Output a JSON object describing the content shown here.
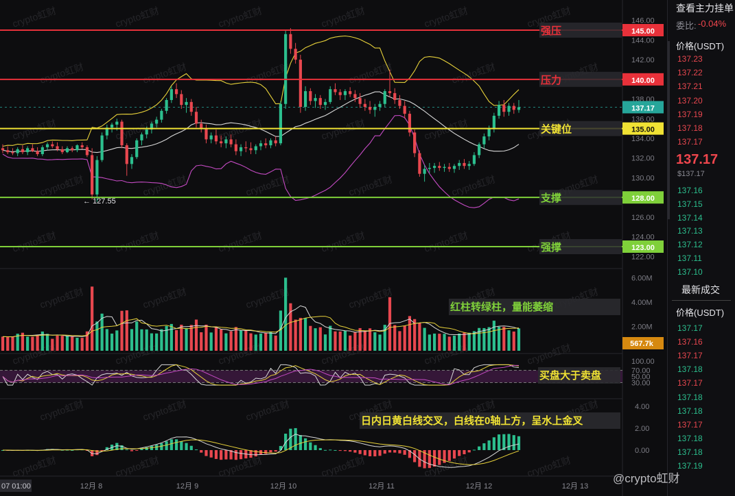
{
  "colors": {
    "up": "#2cbf8e",
    "down": "#e8474f",
    "white_line": "#d9d9d9",
    "yellow_line": "#e8d23a",
    "magenta_line": "#c54bc4",
    "red_level": "#e8313a",
    "yellow_level": "#f0e234",
    "green_level": "#7fd03a",
    "price_teal": "#26a69a",
    "vol_orange": "#d68910"
  },
  "levels": [
    {
      "value": 145.0,
      "label": "强压",
      "tag": "145.00",
      "color": "red"
    },
    {
      "value": 140.0,
      "label": "压力",
      "tag": "140.00",
      "color": "red"
    },
    {
      "value": 135.0,
      "label": "关键位",
      "tag": "135.00",
      "color": "yellow"
    },
    {
      "value": 128.0,
      "label": "支撑",
      "tag": "128.00",
      "color": "green"
    },
    {
      "value": 123.0,
      "label": "强撑",
      "tag": "123.00",
      "color": "green"
    }
  ],
  "current_price_tag": "137.17",
  "current_volume_tag": "567.7k",
  "low_marker": "← 127.55",
  "price_axis_ticks": [
    "146.00",
    "144.00",
    "142.00",
    "140.00",
    "138.00",
    "136.00",
    "134.00",
    "132.00",
    "130.00",
    "128.00",
    "126.00",
    "124.00",
    "122.00"
  ],
  "volume_axis_ticks": [
    "6.00M",
    "4.00M",
    "2.00M"
  ],
  "rsi_axis_ticks": [
    "100.00",
    "70.00",
    "50.00",
    "30.00"
  ],
  "macd_axis_ticks": [
    "4.00",
    "2.00",
    "0.00"
  ],
  "time_axis": {
    "first": "07 01:00",
    "labels": [
      "12月 8",
      "12月 9",
      "12月 10",
      "12月 11",
      "12月 12",
      "12月 13"
    ]
  },
  "annotations": {
    "volume": "红柱转绿柱，量能萎缩",
    "rsi": "买盘大于卖盘",
    "macd": "日内日黄白线交叉，白线在0轴上方，呈水上金叉"
  },
  "watermark_tile": "crypto虹财",
  "corner_watermark": "@crypto虹财",
  "sidebar": {
    "title": "查看主力挂单",
    "ratio_label": "委比:",
    "ratio_value": "-0.04%",
    "price_header": "价格(USDT)",
    "asks": [
      "137.23",
      "137.22",
      "137.21",
      "137.20",
      "137.19",
      "137.18",
      "137.17"
    ],
    "last_price": "137.17",
    "last_price_small": "$137.17",
    "bids": [
      "137.16",
      "137.15",
      "137.14",
      "137.13",
      "137.12",
      "137.11",
      "137.10"
    ],
    "trades_header": "最新成交",
    "trades_price_header": "价格(USDT)",
    "trades": [
      {
        "p": "137.17",
        "s": "buy"
      },
      {
        "p": "137.16",
        "s": "sell"
      },
      {
        "p": "137.17",
        "s": "sell"
      },
      {
        "p": "137.18",
        "s": "buy"
      },
      {
        "p": "137.17",
        "s": "sell"
      },
      {
        "p": "137.18",
        "s": "buy"
      },
      {
        "p": "137.18",
        "s": "buy"
      },
      {
        "p": "137.17",
        "s": "sell"
      },
      {
        "p": "137.18",
        "s": "buy"
      },
      {
        "p": "137.18",
        "s": "buy"
      },
      {
        "p": "137.19",
        "s": "buy"
      }
    ]
  },
  "chart_data": {
    "type": "candlestick",
    "price_ylim": [
      121.5,
      146.5
    ],
    "candles_approx": [
      [
        133.0,
        133.4,
        132.5,
        132.8
      ],
      [
        132.8,
        133.2,
        132.4,
        132.6
      ],
      [
        132.6,
        133.0,
        132.3,
        132.5
      ],
      [
        132.5,
        133.1,
        132.2,
        132.9
      ],
      [
        132.9,
        133.3,
        132.4,
        132.6
      ],
      [
        132.6,
        133.2,
        132.3,
        133.0
      ],
      [
        133.0,
        133.4,
        132.6,
        132.7
      ],
      [
        132.7,
        133.1,
        132.2,
        132.4
      ],
      [
        132.4,
        133.3,
        132.2,
        133.1
      ],
      [
        133.1,
        133.6,
        132.8,
        133.4
      ],
      [
        133.4,
        133.7,
        133.0,
        133.2
      ],
      [
        133.2,
        133.6,
        132.7,
        132.9
      ],
      [
        132.9,
        133.2,
        132.4,
        132.6
      ],
      [
        132.6,
        133.2,
        132.5,
        133.0
      ],
      [
        133.0,
        133.2,
        132.6,
        132.8
      ],
      [
        132.8,
        133.4,
        132.6,
        133.3
      ],
      [
        133.3,
        133.6,
        132.9,
        133.1
      ],
      [
        133.1,
        133.3,
        132.1,
        132.3
      ],
      [
        132.3,
        133.0,
        127.8,
        128.3
      ],
      [
        128.3,
        132.2,
        127.55,
        131.8
      ],
      [
        131.8,
        134.6,
        131.6,
        134.3
      ],
      [
        134.3,
        135.4,
        133.9,
        135.1
      ],
      [
        135.1,
        135.6,
        134.6,
        135.4
      ],
      [
        135.4,
        136.0,
        134.8,
        135.7
      ],
      [
        135.7,
        135.9,
        133.0,
        133.3
      ],
      [
        133.3,
        133.5,
        130.2,
        131.4
      ],
      [
        131.4,
        132.4,
        130.9,
        132.1
      ],
      [
        132.1,
        134.0,
        131.9,
        133.8
      ],
      [
        133.8,
        134.6,
        133.3,
        134.4
      ],
      [
        134.4,
        135.2,
        134.0,
        134.9
      ],
      [
        134.9,
        135.7,
        134.5,
        135.5
      ],
      [
        135.5,
        136.2,
        135.1,
        135.9
      ],
      [
        135.9,
        137.0,
        135.6,
        136.8
      ],
      [
        136.8,
        138.1,
        136.5,
        137.9
      ],
      [
        137.9,
        139.3,
        137.6,
        139.0
      ],
      [
        139.0,
        139.6,
        138.1,
        138.5
      ],
      [
        138.5,
        138.9,
        137.0,
        137.4
      ],
      [
        137.4,
        138.1,
        136.6,
        137.7
      ],
      [
        137.7,
        138.0,
        136.3,
        136.7
      ],
      [
        136.7,
        137.2,
        135.1,
        135.5
      ],
      [
        135.5,
        135.9,
        134.6,
        135.0
      ],
      [
        135.0,
        135.4,
        133.5,
        133.9
      ],
      [
        133.9,
        134.6,
        133.5,
        134.3
      ],
      [
        134.3,
        134.9,
        133.4,
        133.7
      ],
      [
        133.7,
        134.3,
        133.1,
        133.5
      ],
      [
        133.5,
        134.2,
        133.0,
        133.9
      ],
      [
        133.9,
        134.4,
        133.1,
        133.4
      ],
      [
        133.4,
        133.9,
        132.3,
        132.7
      ],
      [
        132.7,
        133.4,
        132.2,
        133.1
      ],
      [
        133.1,
        133.7,
        132.6,
        133.0
      ],
      [
        133.0,
        133.6,
        132.4,
        132.8
      ],
      [
        132.8,
        133.4,
        132.4,
        133.2
      ],
      [
        133.2,
        133.8,
        132.8,
        133.5
      ],
      [
        133.5,
        134.0,
        133.0,
        133.3
      ],
      [
        133.3,
        134.0,
        133.0,
        133.8
      ],
      [
        133.8,
        134.2,
        133.2,
        133.5
      ],
      [
        133.5,
        137.8,
        133.3,
        137.5
      ],
      [
        137.5,
        145.0,
        137.0,
        144.6
      ],
      [
        144.6,
        145.2,
        142.6,
        143.1
      ],
      [
        143.1,
        143.7,
        141.6,
        142.0
      ],
      [
        142.0,
        142.5,
        136.6,
        137.2
      ],
      [
        137.2,
        139.3,
        136.8,
        138.8
      ],
      [
        138.8,
        139.1,
        137.4,
        137.8
      ],
      [
        137.8,
        138.5,
        137.1,
        138.1
      ],
      [
        138.1,
        138.4,
        137.0,
        137.4
      ],
      [
        137.4,
        138.0,
        136.9,
        137.7
      ],
      [
        137.7,
        139.3,
        137.5,
        139.0
      ],
      [
        139.0,
        139.6,
        138.4,
        138.7
      ],
      [
        138.7,
        139.0,
        137.9,
        138.4
      ],
      [
        138.4,
        139.0,
        137.9,
        138.8
      ],
      [
        138.8,
        139.2,
        138.2,
        138.5
      ],
      [
        138.5,
        138.9,
        137.7,
        138.1
      ],
      [
        138.1,
        138.6,
        137.1,
        137.5
      ],
      [
        137.5,
        138.0,
        136.8,
        137.2
      ],
      [
        137.2,
        137.8,
        136.5,
        136.9
      ],
      [
        136.9,
        137.5,
        136.2,
        137.2
      ],
      [
        137.2,
        137.8,
        136.8,
        137.5
      ],
      [
        137.5,
        139.0,
        137.2,
        138.8
      ],
      [
        138.8,
        141.0,
        138.2,
        138.6
      ],
      [
        138.6,
        139.1,
        137.5,
        137.9
      ],
      [
        137.9,
        138.4,
        137.0,
        137.3
      ],
      [
        137.3,
        137.8,
        136.0,
        136.5
      ],
      [
        136.5,
        136.8,
        134.2,
        134.6
      ],
      [
        134.6,
        134.9,
        132.1,
        132.5
      ],
      [
        132.5,
        132.8,
        130.1,
        130.4
      ],
      [
        130.4,
        131.3,
        129.6,
        130.9
      ],
      [
        130.9,
        131.5,
        130.5,
        131.0
      ],
      [
        131.0,
        131.5,
        130.5,
        131.2
      ],
      [
        131.2,
        131.6,
        130.7,
        131.0
      ],
      [
        131.0,
        131.4,
        130.6,
        131.1
      ],
      [
        131.1,
        131.5,
        130.6,
        130.9
      ],
      [
        130.9,
        131.4,
        130.5,
        131.2
      ],
      [
        131.2,
        131.8,
        130.8,
        131.5
      ],
      [
        131.5,
        131.9,
        130.9,
        131.2
      ],
      [
        131.2,
        131.7,
        130.8,
        131.4
      ],
      [
        131.4,
        132.6,
        131.2,
        132.3
      ],
      [
        132.3,
        133.6,
        132.0,
        133.4
      ],
      [
        133.4,
        134.5,
        133.0,
        134.2
      ],
      [
        134.2,
        135.3,
        133.8,
        135.0
      ],
      [
        135.0,
        136.6,
        134.6,
        136.3
      ],
      [
        136.3,
        137.8,
        136.0,
        137.4
      ],
      [
        137.4,
        137.9,
        136.2,
        136.7
      ],
      [
        136.7,
        137.6,
        136.3,
        137.3
      ],
      [
        137.3,
        137.6,
        136.5,
        136.9
      ],
      [
        136.9,
        137.9,
        136.6,
        137.17
      ]
    ]
  }
}
